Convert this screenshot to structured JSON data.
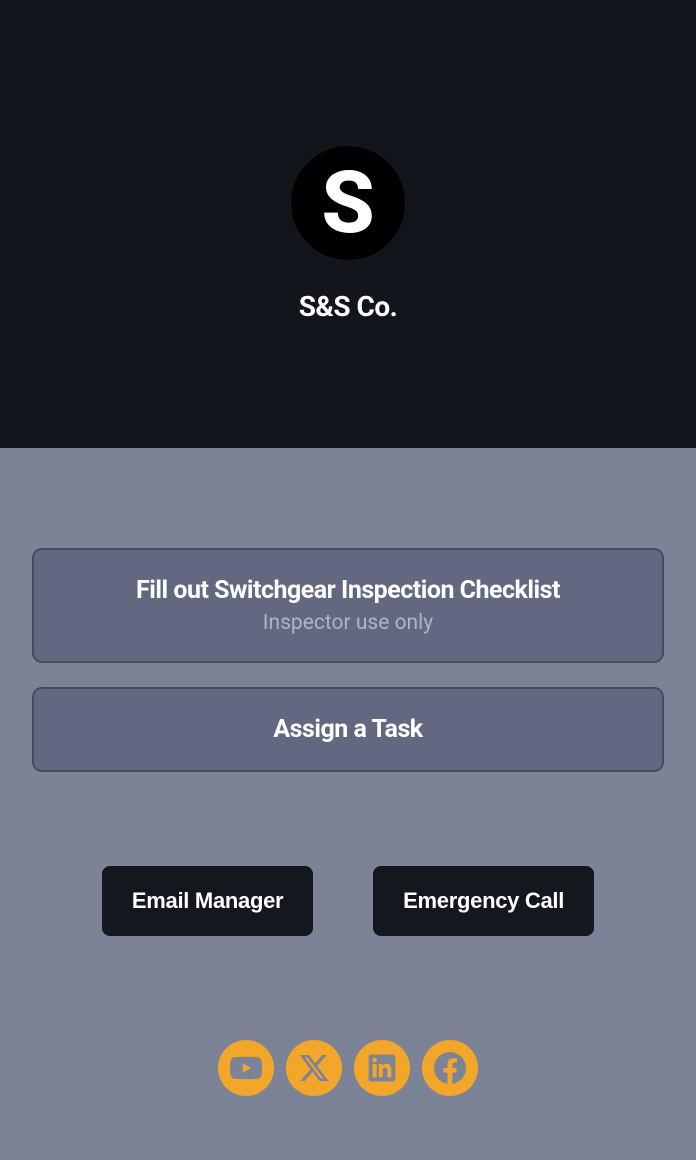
{
  "header": {
    "logo_letter": "S",
    "company_name": "S&S Co."
  },
  "main": {
    "buttons": [
      {
        "title": "Fill out Switchgear Inspection Checklist",
        "subtitle": "Inspector use only"
      },
      {
        "title": "Assign a Task"
      }
    ],
    "action_buttons": [
      {
        "label": "Email Manager"
      },
      {
        "label": "Emergency Call"
      }
    ]
  },
  "social": {
    "icons": [
      "youtube",
      "x-twitter",
      "linkedin",
      "facebook"
    ]
  }
}
